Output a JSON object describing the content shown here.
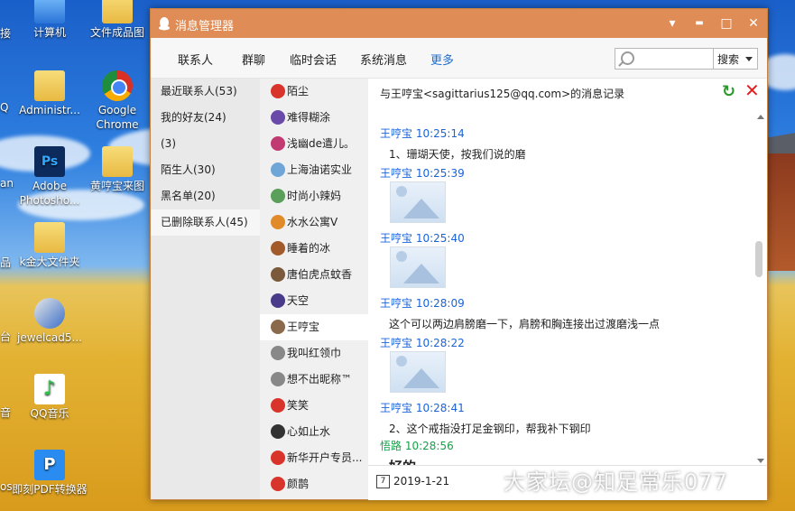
{
  "desktop": {
    "icons": [
      {
        "label": "计算机"
      },
      {
        "label": "文件成品图"
      },
      {
        "label": "Administr..."
      },
      {
        "label": "Google Chrome"
      },
      {
        "label": "Adobe Photosho..."
      },
      {
        "label": "黄哼宝来图"
      },
      {
        "label": "k金大文件夹"
      },
      {
        "label": "jewelcad5..."
      },
      {
        "label": "QQ音乐"
      },
      {
        "label": "即刻PDF转换器"
      }
    ],
    "partial_labels": [
      "接",
      "Q",
      "an",
      "品",
      "台",
      "音",
      "os"
    ]
  },
  "window": {
    "title": "消息管理器",
    "controls": {
      "menu": "▾",
      "minimize": "▬",
      "maximize": "□",
      "close": "✕"
    },
    "tabs": [
      "联系人",
      "群聊",
      "临时会话",
      "系统消息",
      "更多"
    ],
    "active_tab": "更多",
    "search": {
      "placeholder": "",
      "button": "搜索"
    }
  },
  "categories": [
    {
      "label": "最近联系人(53)"
    },
    {
      "label": "我的好友(24)"
    },
    {
      "label": "(3)"
    },
    {
      "label": "陌生人(30)"
    },
    {
      "label": "黑名单(20)"
    },
    {
      "label": "已删除联系人(45)"
    }
  ],
  "selected_category": "已删除联系人(45)",
  "contacts": [
    {
      "name": "陌尘",
      "color": "#d9342b"
    },
    {
      "name": "难得糊涂",
      "color": "#6a4aa8"
    },
    {
      "name": "浅幽de遣儿。",
      "color": "#c23a72"
    },
    {
      "name": "上海油诺实业",
      "color": "#6fa6d8"
    },
    {
      "name": "时尚小辣妈",
      "color": "#5aa05a"
    },
    {
      "name": "水水公寓V",
      "color": "#e08a2a"
    },
    {
      "name": "睡着的冰",
      "color": "#a25a2a"
    },
    {
      "name": "唐伯虎点蚊香",
      "color": "#7a5a3a"
    },
    {
      "name": "天空",
      "color": "#4a3a8a"
    },
    {
      "name": "王哼宝",
      "color": "#8a6a4a"
    },
    {
      "name": "我叫红领巾",
      "color": "#888888"
    },
    {
      "name": "想不出昵称™",
      "color": "#888888"
    },
    {
      "name": "笑笑",
      "color": "#d9342b"
    },
    {
      "name": "心如止水",
      "color": "#333333"
    },
    {
      "name": "新华开户专员...",
      "color": "#d9342b"
    },
    {
      "name": "颜鹊",
      "color": "#d9342b"
    }
  ],
  "selected_contact": "王哼宝",
  "chat": {
    "header": "与王哼宝<sagittarius125@qq.com>的消息记录",
    "messages": [
      {
        "sender": "王哼宝 10:25:14",
        "text": "1、珊瑚天使，按我们说的磨"
      },
      {
        "sender": "王哼宝 10:25:39",
        "image": true
      },
      {
        "sender": "王哼宝 10:25:40",
        "image": true
      },
      {
        "sender": "王哼宝 10:28:09",
        "text": "这个可以两边肩膀磨一下，肩膀和胸连接出过渡磨浅一点"
      },
      {
        "sender": "王哼宝 10:28:22",
        "image": true
      },
      {
        "sender": "王哼宝 10:28:41",
        "text": "2、这个戒指没打足金钢印，帮我补下钢印"
      },
      {
        "sender": "悟路 10:28:56",
        "text": "好的",
        "self": true
      }
    ],
    "date": "2019-1-21",
    "calendar_icon_text": "7"
  },
  "watermark": "大家坛@知足常乐077",
  "colors": {
    "titlebar": "#df8c56",
    "link_blue": "#1a63d8",
    "self_green": "#17a04a"
  }
}
